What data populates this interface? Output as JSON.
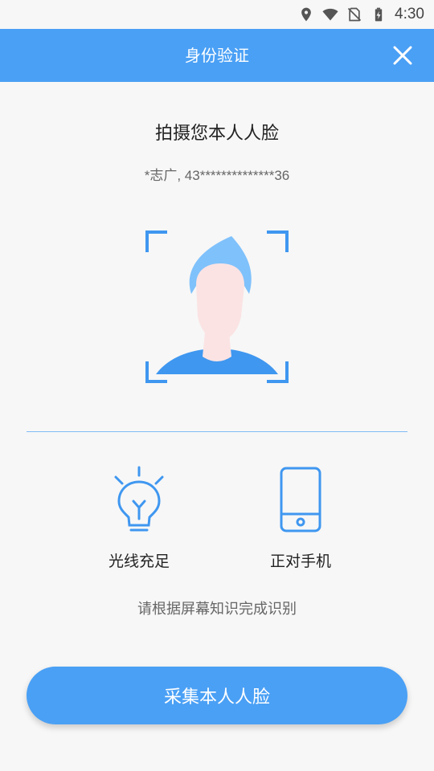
{
  "status_bar": {
    "time": "4:30",
    "icons": [
      "location-icon",
      "wifi-icon",
      "no-sim-icon",
      "battery-charging-icon"
    ]
  },
  "app_bar": {
    "title": "身份验证",
    "close_icon": "close-icon"
  },
  "content": {
    "title": "拍摄您本人人脸",
    "user_info": "*志广, 43**************36",
    "tips": [
      {
        "icon": "lightbulb-icon",
        "label": "光线充足"
      },
      {
        "icon": "phone-icon",
        "label": "正对手机"
      }
    ],
    "hint": "请根据屏幕知识完成识别",
    "capture_button": "采集本人人脸"
  },
  "colors": {
    "primary": "#4aa0f5",
    "icon_blue": "#3f97f0",
    "face_skin": "#fbe3e3",
    "hair": "#7fc1fb",
    "background": "#f7f7f7"
  }
}
